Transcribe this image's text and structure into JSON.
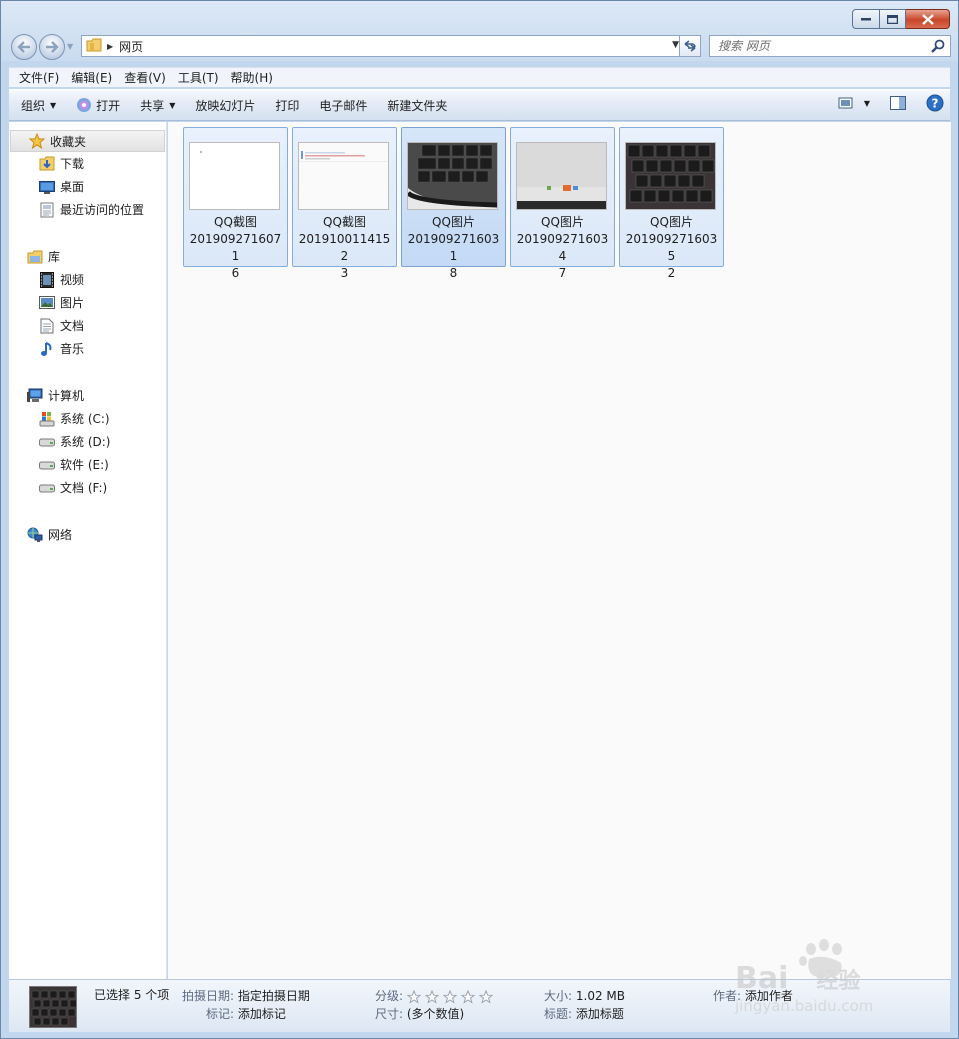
{
  "window": {
    "caption_buttons": [
      "minimize",
      "maximize",
      "close"
    ]
  },
  "address": {
    "crumbs": [
      "网页"
    ],
    "search_placeholder": "搜索 网页"
  },
  "menubar": {
    "items": [
      "文件(F)",
      "编辑(E)",
      "查看(V)",
      "工具(T)",
      "帮助(H)"
    ]
  },
  "toolbar": {
    "organize": "组织",
    "open": "打开",
    "share": "共享",
    "slideshow": "放映幻灯片",
    "print": "打印",
    "email": "电子邮件",
    "new_folder": "新建文件夹"
  },
  "sidebar": {
    "favorites": {
      "label": "收藏夹",
      "items": [
        {
          "label": "下载",
          "icon": "download-folder-icon"
        },
        {
          "label": "桌面",
          "icon": "desktop-icon"
        },
        {
          "label": "最近访问的位置",
          "icon": "recent-places-icon"
        }
      ]
    },
    "libraries": {
      "label": "库",
      "items": [
        {
          "label": "视频",
          "icon": "video-icon"
        },
        {
          "label": "图片",
          "icon": "pictures-icon"
        },
        {
          "label": "文档",
          "icon": "documents-icon"
        },
        {
          "label": "音乐",
          "icon": "music-icon"
        }
      ]
    },
    "computer": {
      "label": "计算机",
      "items": [
        {
          "label": "系统 (C:)",
          "icon": "system-drive-icon"
        },
        {
          "label": "系统 (D:)",
          "icon": "drive-icon"
        },
        {
          "label": "软件 (E:)",
          "icon": "drive-icon"
        },
        {
          "label": "文档 (F:)",
          "icon": "drive-icon"
        }
      ]
    },
    "network": {
      "label": "网络"
    }
  },
  "files": [
    {
      "name_line1": "QQ截图",
      "name_line2": "2019092716071",
      "name_line3": "6",
      "thumb": "blank-screenshot"
    },
    {
      "name_line1": "QQ截图",
      "name_line2": "2019100114152",
      "name_line3": "3",
      "thumb": "web-screenshot"
    },
    {
      "name_line1": "QQ图片",
      "name_line2": "2019092716031",
      "name_line3": "8",
      "thumb": "keyboard-photo"
    },
    {
      "name_line1": "QQ图片",
      "name_line2": "2019092716034",
      "name_line3": "7",
      "thumb": "monitor-photo"
    },
    {
      "name_line1": "QQ图片",
      "name_line2": "2019092716035",
      "name_line3": "2",
      "thumb": "keyboard-photo-2"
    }
  ],
  "details": {
    "selected": "已选择 5 个项",
    "date_taken_label": "拍摄日期:",
    "date_taken_value": "指定拍摄日期",
    "tags_label": "标记:",
    "tags_value": "添加标记",
    "rating_label": "分级:",
    "rating_stars": 0,
    "rating_max": 5,
    "dimensions_label": "尺寸:",
    "dimensions_value": "(多个数值)",
    "size_label": "大小:",
    "size_value": "1.02 MB",
    "title_label": "标题:",
    "title_value": "添加标题",
    "author_label": "作者:",
    "author_value": "添加作者"
  },
  "watermark": {
    "brand": "Bai",
    "brand_suffix": "经验",
    "url": "jingyan.baidu.com"
  }
}
